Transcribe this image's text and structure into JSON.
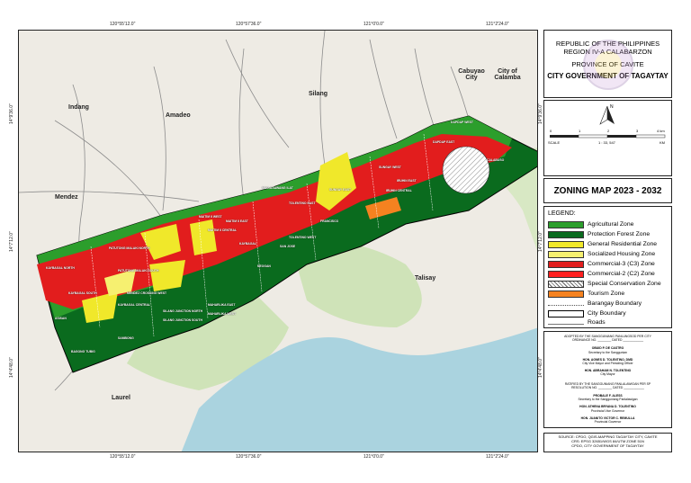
{
  "grid_labels": {
    "top": [
      "120°55'12.0\"",
      "120°57'36.0\"",
      "121°0'0.0\"",
      "121°2'24.0\""
    ],
    "bottom": [
      "120°55'12.0\"",
      "120°57'36.0\"",
      "121°0'0.0\"",
      "121°2'24.0\""
    ],
    "left": [
      "14°9'36.0\"",
      "14°7'12.0\"",
      "14°4'48.0\""
    ],
    "right": [
      "14°9'36.0\"",
      "14°7'12.0\"",
      "14°4'48.0\""
    ]
  },
  "places": {
    "indang": "Indang",
    "amadeo": "Amadeo",
    "silang": "Silang",
    "cabuyao": "Cabuyao City",
    "calamba": "City of Calamba",
    "mendez": "Mendez",
    "talisay": "Talisay",
    "laurel": "Laurel"
  },
  "barangays": [
    "KAYBAGAL NORTH",
    "KAYBAGAL SOUTH",
    "KAYBAGAL CENTRAL",
    "SILANG JUNCTION NORTH",
    "SILANG JUNCTION SOUTH",
    "MAHARLIKA EAST",
    "MAHARLIKA WEST",
    "SAN JOSE",
    "NEOGAN",
    "KAYBAGAL",
    "MAITIM II EAST",
    "MAITIM II WEST",
    "MAITIM II CENTRAL",
    "SUNGAY EAST",
    "SUNGAY WEST",
    "DAPDAP EAST",
    "DAPDAP WEST",
    "CALABUSO",
    "IRUHIN EAST",
    "IRUHIN WEST",
    "IRUHIN CENTRAL",
    "PATUTONG MALAKI NORTH",
    "PATUTONG MALAKI SOUTH",
    "ASISAN",
    "BAGONG TUBIG",
    "TOLENTINO EAST",
    "TOLENTINO WEST",
    "MAG-ASAWANG ILAT",
    "CALABUSO",
    "BAGONG POOK",
    "SAMBONG",
    "MENDEZ CROSSING WEST",
    "MENDEZ CROSSING EAST",
    "GUINHAWA NORTH",
    "GUINHAWA SOUTH",
    "FRANCISCO",
    "SAN JOSE",
    "ZAMBAL",
    "SILANG CROSSING EAST",
    "SILANG CROSSING WEST"
  ],
  "title_block": {
    "line1": "REPUBLIC OF THE PHILIPPINES",
    "line2": "REGION IV-A CALABARZON",
    "line3": "PROVINCE OF CAVITE",
    "line4": "CITY GOVERNMENT OF TAGAYTAY"
  },
  "scale": {
    "ticks": [
      "0",
      "1",
      "2",
      "3",
      "4 km"
    ],
    "label": "SCALE",
    "ratio": "1 : 33, 547",
    "unit": "KM",
    "north": "N"
  },
  "map_title": "ZONING MAP 2023 - 2032",
  "legend": {
    "title": "LEGEND:",
    "items": [
      {
        "label": "Agricultural Zone",
        "color": "#2c9e2c",
        "kind": "fill"
      },
      {
        "label": "Protection Forest Zone",
        "color": "#0a6b1e",
        "kind": "fill"
      },
      {
        "label": "General Residential Zone",
        "color": "#f0e82a",
        "kind": "fill"
      },
      {
        "label": "Socialized Housing Zone",
        "color": "#f6f070",
        "kind": "fill"
      },
      {
        "label": "Commercial-3 (C3) Zone",
        "color": "#e21d1d",
        "kind": "fill"
      },
      {
        "label": "Commercial-2 (C2) Zone",
        "color": "#ff2020",
        "kind": "fill"
      },
      {
        "label": "Special Conservation Zone",
        "color": "#ffffff",
        "kind": "hatch"
      },
      {
        "label": "Tourism Zone",
        "color": "#f58220",
        "kind": "fill"
      },
      {
        "label": "Barangay Boundary",
        "color": "#555555",
        "kind": "dotted"
      },
      {
        "label": "City Boundary",
        "color": "#000000",
        "kind": "box"
      },
      {
        "label": "Roads",
        "color": "#777777",
        "kind": "line"
      }
    ]
  },
  "adoption": {
    "l1": "ADOPTED BY THE SANGGUNIANG PANLUNGSOD PER CITY",
    "l2": "ORDINANCE NO. ________ DATED ____________",
    "n1": "OBUID P. DE CASTRO",
    "r1": "Secretary to the Sanggunian",
    "n2": "HON. AGNES D. TOLENTINO, DMD",
    "r2": "City Vice Mayor and Presiding Officer",
    "n3": "HON. ABRAHAM N. TOLENTINO",
    "r3": "City Mayor",
    "l3": "RATIFIED BY THE SANGGUNIANG PANLALAWIGAN PER SP",
    "l4": "RESOLUTION NO. ________ DATED ____________",
    "n4": "PROBALE F. ALESS",
    "r4": "Secretary to the Sangguniang Panlalawigan",
    "n5": "HON. ATHENA BRYANA D. TOLENTINO",
    "r5": "Provincial Vice Governor",
    "n6": "HON. JUANITO VICTOR C. REMULLA",
    "r6": "Provincial Governor"
  },
  "source": {
    "l1": "SOURCE: CPDO, QGIS-MAPPING TAGAYTAY CITY, CAVITE",
    "l2": "CRS: EPSG 32651/WGS 84/UTM ZONE 51N",
    "l3": "CPDO, CITY GOVERNMENT OF TAGAYTAY"
  }
}
